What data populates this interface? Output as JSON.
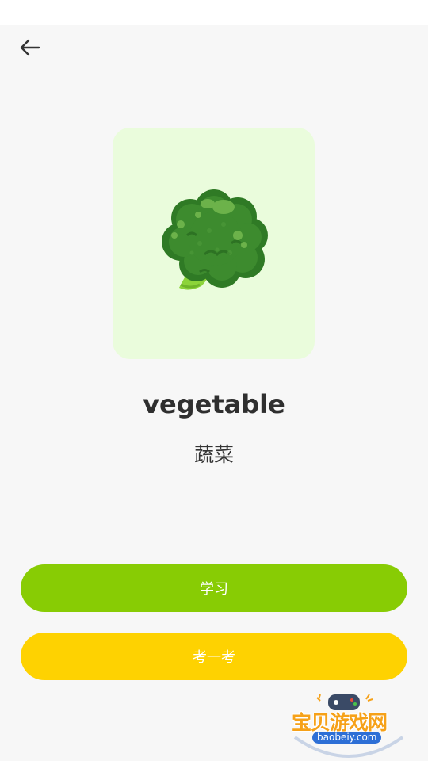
{
  "word": {
    "english": "vegetable",
    "chinese": "蔬菜",
    "image_icon": "broccoli-illustration"
  },
  "actions": {
    "learn_label": "学习",
    "test_label": "考一考"
  },
  "navigation": {
    "back_icon": "back-arrow-icon"
  },
  "watermark": {
    "site_name": "宝贝游戏网",
    "url": "baobeiy.com"
  },
  "colors": {
    "background": "#f7f7f7",
    "card_background": "#eafcdc",
    "learn_button": "#88cc04",
    "test_button": "#fed201",
    "word_text": "#2f2f2f"
  }
}
